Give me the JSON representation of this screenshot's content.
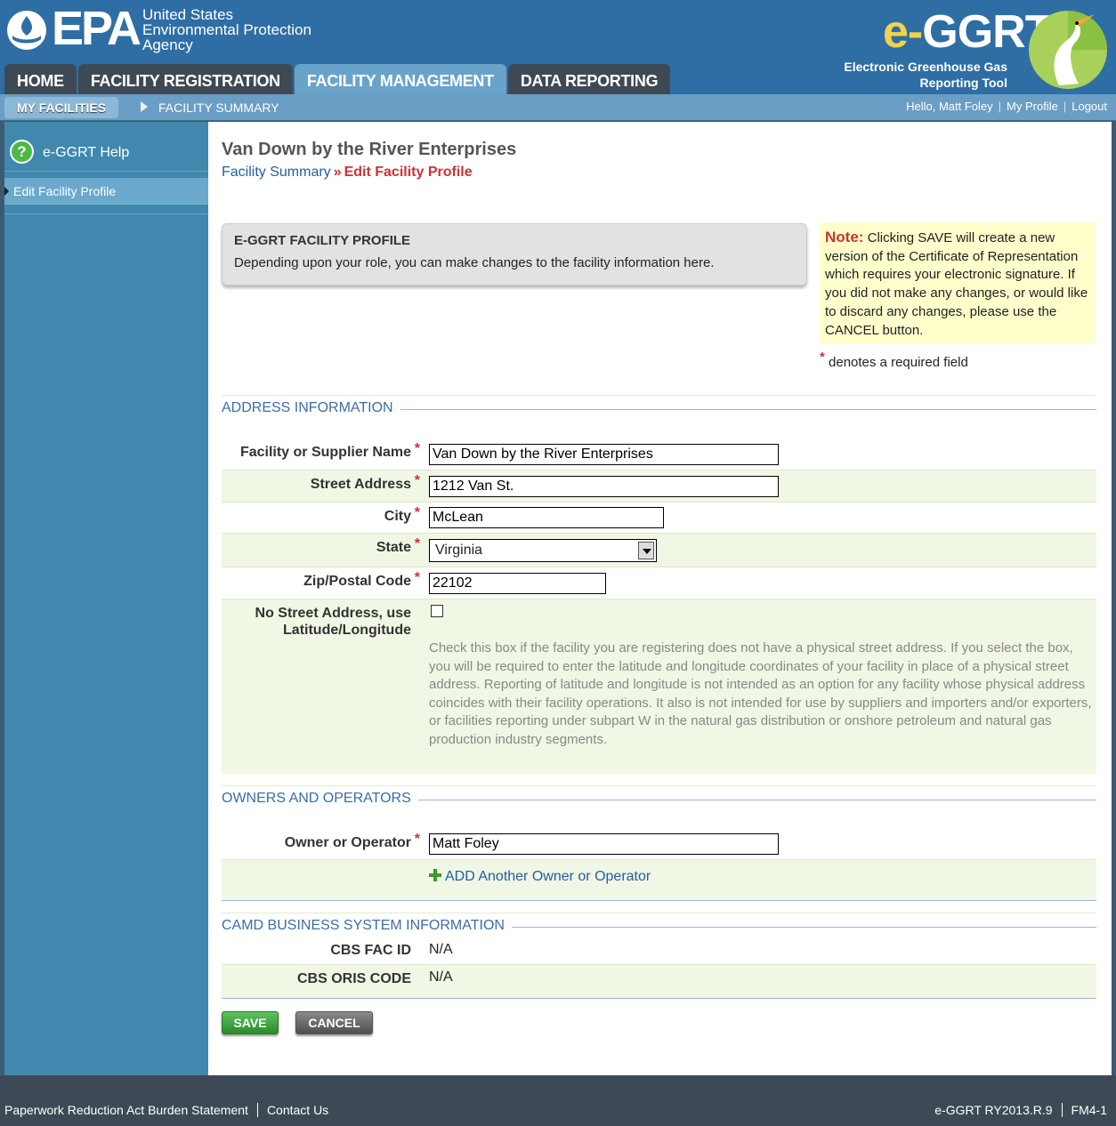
{
  "header": {
    "epa_letters": "EPA",
    "epa_agency_lines": [
      "United States",
      "Environmental Protection",
      "Agency"
    ],
    "app_logo_prefix": "e-",
    "app_logo_name": "GGRT",
    "app_subtitle_lines": [
      "Electronic Greenhouse Gas",
      "Reporting Tool"
    ],
    "tabs": [
      {
        "label": "HOME",
        "active": false
      },
      {
        "label": "FACILITY REGISTRATION",
        "active": false
      },
      {
        "label": "FACILITY MANAGEMENT",
        "active": true
      },
      {
        "label": "DATA REPORTING",
        "active": false
      }
    ]
  },
  "subnav": {
    "active_label": "MY FACILITIES",
    "item_label": "FACILITY SUMMARY",
    "greeting": "Hello, Matt Foley",
    "my_profile": "My Profile",
    "logout": "Logout"
  },
  "sidebar": {
    "help_label": "e-GGRT Help",
    "items": [
      {
        "label": "Edit Facility Profile"
      }
    ]
  },
  "content": {
    "page_title": "Van Down by the River Enterprises",
    "breadcrumb": {
      "link": "Facility Summary",
      "separator": "»",
      "current": "Edit Facility Profile"
    },
    "profile_box": {
      "title": "E-GGRT FACILITY PROFILE",
      "description": "Depending upon your role, you can make changes to the facility information here."
    },
    "note": {
      "label": "Note:",
      "text": "Clicking SAVE will create a new version of the Certificate of Representation which requires your electronic signature. If you did not make any changes, or would like to discard any changes, please use the CANCEL button."
    },
    "required_marker": "*",
    "required_note": "denotes a required field",
    "address": {
      "section_title": "ADDRESS INFORMATION",
      "facility_name_label": "Facility or Supplier Name",
      "facility_name_value": "Van Down by the River Enterprises",
      "street_label": "Street Address",
      "street_value": "1212 Van St.",
      "city_label": "City",
      "city_value": "McLean",
      "state_label": "State",
      "state_value": "Virginia",
      "zip_label": "Zip/Postal Code",
      "zip_value": "22102",
      "no_street_label_line1": "No Street Address, use",
      "no_street_label_line2": "Latitude/Longitude",
      "no_street_help": "Check this box if the facility you are registering does not have a physical street address. If you select the box, you will be required to enter the latitude and longitude coordinates of your facility in place of a physical street address. Reporting of latitude and longitude is not intended as an option for any facility whose physical address coincides with their facility operations. It also is not intended for use by suppliers and importers and/or exporters, or facilities reporting under subpart W in the natural gas distribution or onshore petroleum and natural gas production industry segments."
    },
    "owners": {
      "section_title": "OWNERS AND OPERATORS",
      "owner_label": "Owner or Operator",
      "owner_value": "Matt Foley",
      "add_link": "ADD Another Owner or Operator"
    },
    "camd": {
      "section_title": "CAMD BUSINESS SYSTEM INFORMATION",
      "cbs_fac_id_label": "CBS FAC ID",
      "cbs_fac_id_value": "N/A",
      "cbs_oris_label": "CBS ORIS CODE",
      "cbs_oris_value": "N/A"
    },
    "buttons": {
      "save": "SAVE",
      "cancel": "CANCEL"
    }
  },
  "footer": {
    "paperwork": "Paperwork Reduction Act Burden Statement",
    "contact": "Contact Us",
    "version": "e-GGRT RY2013.R.9",
    "page_code": "FM4-1"
  },
  "colors": {
    "header_blue": "#2f6ea5",
    "sidebar_blue": "#4088ad",
    "link_blue": "#1f5fa6",
    "required_red": "#cc3333",
    "note_yellow": "#ffffcc",
    "row_green": "#f0f7e4",
    "save_green": "#3aa33a"
  }
}
